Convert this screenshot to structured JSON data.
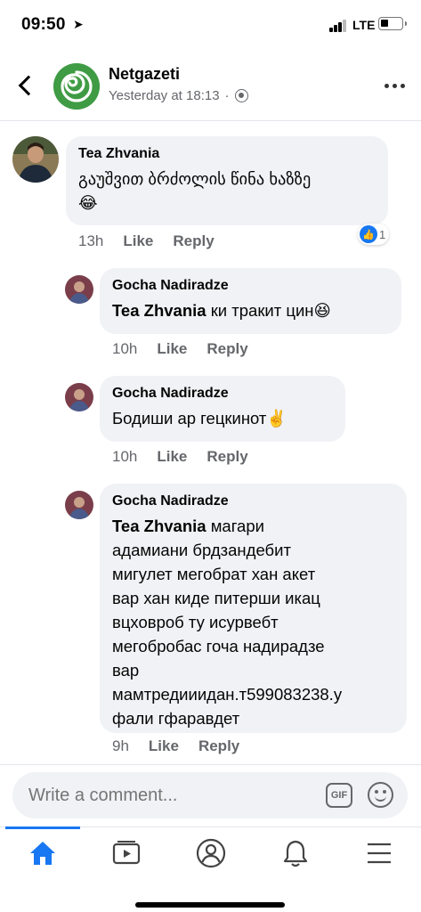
{
  "status_bar": {
    "time": "09:50",
    "network": "LTE"
  },
  "header": {
    "page_name": "Netgazeti",
    "timestamp": "Yesterday at 18:13"
  },
  "comments": [
    {
      "author": "Tea Zhvania",
      "mention": "",
      "text": "გაუშვით ბრძოლის წინა ხაზზე",
      "emoji": "😂",
      "time": "13h",
      "like": "Like",
      "reply": "Reply",
      "reaction_count": "1"
    },
    {
      "author": "Gocha Nadiradze",
      "mention": "Tea Zhvania",
      "text": " ки тракит цин",
      "emoji": "😆",
      "time": "10h",
      "like": "Like",
      "reply": "Reply"
    },
    {
      "author": "Gocha Nadiradze",
      "mention": "",
      "text": "Бодиши ар гецкинот",
      "emoji": "✌️",
      "time": "10h",
      "like": "Like",
      "reply": "Reply"
    },
    {
      "author": "Gocha Nadiradze",
      "mention": "Tea Zhvania",
      "text_lines": [
        " магари",
        "адамиани брдзандебит",
        "мигулет мегобрат хан акет",
        "вар хан киде питерши икац",
        "вцховроб ту исурвебт",
        "мегобробас гоча надирадзе",
        "вар",
        "мамтредииидан.т599083238.у",
        "фали гфаравдет"
      ],
      "time": "9h",
      "like": "Like",
      "reply": "Reply"
    }
  ],
  "composer": {
    "placeholder": "Write a comment...",
    "gif_label": "GIF"
  },
  "tabs": [
    "home-icon",
    "watch-icon",
    "profile-icon",
    "notifications-icon",
    "menu-icon"
  ],
  "colors": {
    "accent": "#1877f2",
    "bubble": "#f0f2f5",
    "secondary_text": "#65676b",
    "page_logo": "#3f9b44"
  }
}
